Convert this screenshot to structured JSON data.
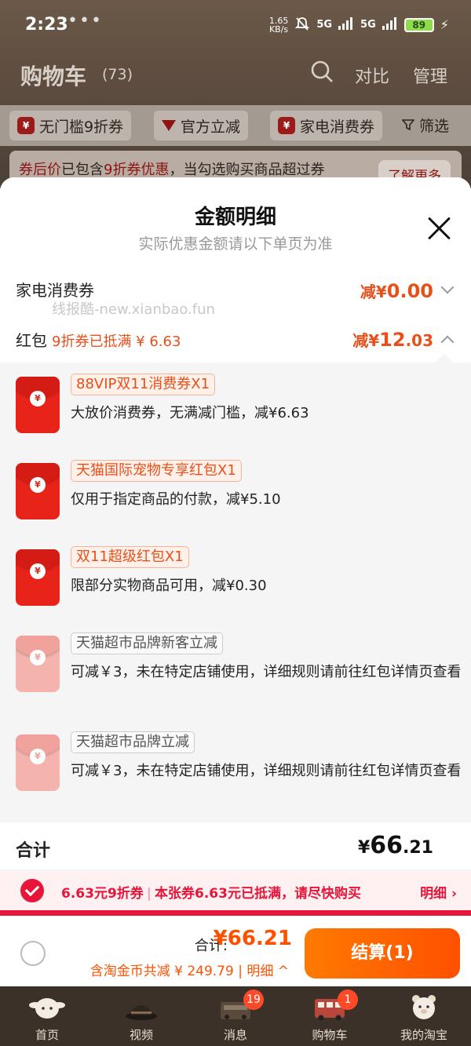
{
  "status": {
    "time": "2:23",
    "dots": "•••",
    "speed": "1.65\nKB/s",
    "net1": "5G",
    "net2": "5G",
    "battery": "89"
  },
  "cart": {
    "title": "购物车",
    "count": "(73)",
    "compare": "对比",
    "manage": "管理"
  },
  "filters": {
    "chips": [
      "无门槛9折券",
      "官方立减",
      "家电消费券"
    ],
    "filter_label": "筛选"
  },
  "promo": {
    "prefix": "券后价",
    "mid": "已包含",
    "highlight": "9折券优惠",
    "rest": "，当勾选购买商品超过券",
    "learn_more": "了解更多"
  },
  "modal": {
    "title": "金额明细",
    "subtitle": "实际优惠金额请以下单页为准",
    "appliance": {
      "label": "家电消费券",
      "amount_prefix": "减¥",
      "amount_main": "0.00"
    },
    "watermark": "线报酷-new.xianbao.fun",
    "hongbao": {
      "label": "红包",
      "sub": "9折券已抵满 ¥ 6.63",
      "amount_prefix": "减¥",
      "amount_main": "12",
      "amount_dec": ".03"
    },
    "coupons": [
      {
        "tag": "88VIP双11消费券X1",
        "desc": "大放价消费券，无满减门槛，减¥6.63",
        "active": true
      },
      {
        "tag": "天猫国际宠物专享红包X1",
        "desc": "仅用于指定商品的付款，减¥5.10",
        "active": true
      },
      {
        "tag": "双11超级红包X1",
        "desc": "限部分实物商品可用，减¥0.30",
        "active": true
      },
      {
        "tag": "天猫超市品牌新客立减",
        "desc": "可减￥3，未在特定店铺使用，详细规则请前往红包详情页查看",
        "active": false
      },
      {
        "tag": "天猫超市品牌立减",
        "desc": "可减￥3，未在特定店铺使用，详细规则请前往红包详情页查看",
        "active": false
      }
    ],
    "coin_symbol": "¥",
    "total_label": "合计",
    "total_currency": "¥",
    "total_int": "66",
    "total_dec": ".21"
  },
  "strip": {
    "coupon": "6.63元9折券",
    "sep": "|",
    "message": "本张券6.63元已抵满，请尽快购买",
    "detail": "明细 ›"
  },
  "checkout": {
    "total_label": "合计:",
    "total": "¥66.21",
    "sub": "含淘金币共减 ¥ 249.79 | 明细 ^",
    "button": "结算(1)"
  },
  "tabs": [
    {
      "label": "首页",
      "icon": "cinnamoroll-icon"
    },
    {
      "label": "视频",
      "icon": "hat-icon"
    },
    {
      "label": "消息",
      "icon": "message-icon",
      "badge": "19"
    },
    {
      "label": "购物车",
      "icon": "cart-bus-icon",
      "badge": "1"
    },
    {
      "label": "我的淘宝",
      "icon": "bear-icon"
    }
  ],
  "colors": {
    "accent": "#ff5000",
    "discount": "#e7501a",
    "coupon_red": "#e6153a",
    "tabbar": "#3b3128"
  }
}
